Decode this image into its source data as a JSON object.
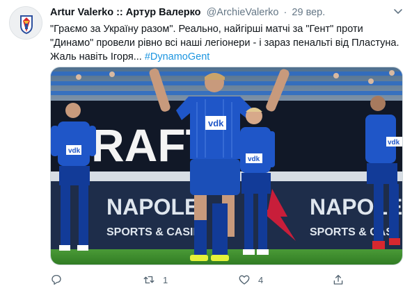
{
  "tweet": {
    "author_name": "Artur Valerko :: Артур Валерко",
    "author_handle": "@ArchieValerko",
    "separator": "·",
    "date": "29 вер.",
    "text_main": "\"Граємо за Україну разом\". Реально, найгірші матчі за \"Гент\" проти \"Динамо\" провели рівно всі наші легіонери - і зараз пенальті від Пластуна. Жаль навіть Ігоря... ",
    "hashtag": "#DynamoGent",
    "image": {
      "banner_text_left": "NAPOLE",
      "banner_text_right": "NAPOLE",
      "banner_sub_left": "SPORTS & CASIN",
      "banner_sub_right": "SPORTS & CAS",
      "stand_text": "RAFT",
      "shirt_sponsor": "vdk",
      "colors": {
        "kit": "#1f56c8",
        "kit_dark": "#123b98",
        "pitch": "#3d8a2c",
        "banner": "#1e2d4a"
      }
    }
  },
  "actions": {
    "reply_count": "",
    "retweet_count": "1",
    "like_count": "4",
    "icons": [
      "reply-icon",
      "retweet-icon",
      "like-icon",
      "share-icon"
    ]
  },
  "colors": {
    "link": "#1b95e0",
    "secondary_text": "#657786",
    "icon": "#536471"
  }
}
